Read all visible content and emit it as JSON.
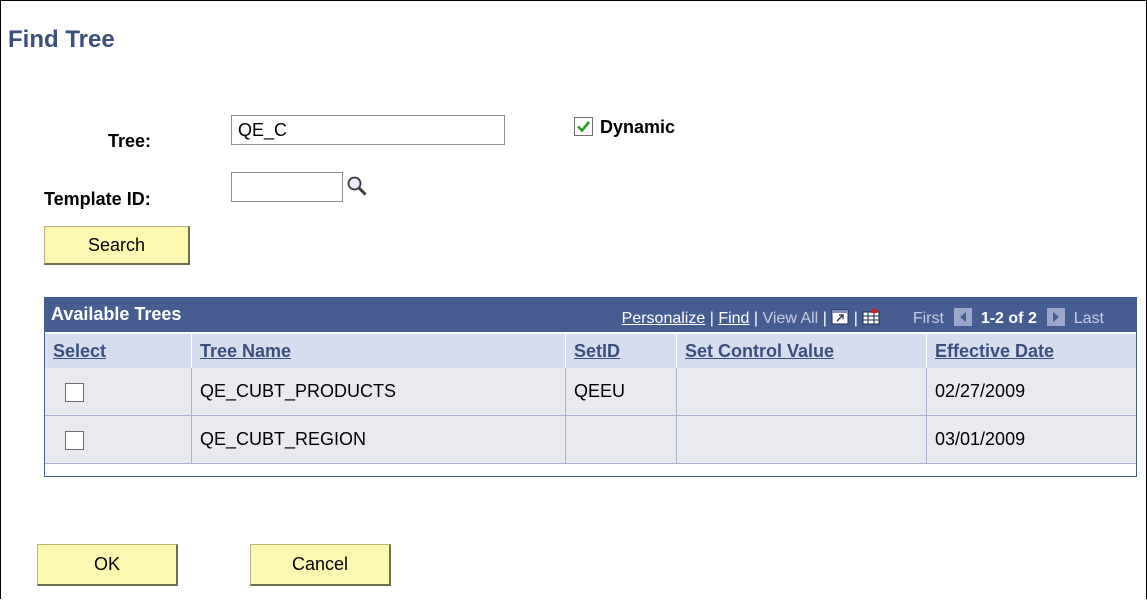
{
  "page": {
    "title": "Find Tree"
  },
  "form": {
    "tree_label": "Tree:",
    "tree_value": "QE_C",
    "dynamic_label": "Dynamic",
    "dynamic_checked": true,
    "template_label": "Template ID:",
    "template_value": "",
    "search_label": "Search"
  },
  "grid": {
    "title": "Available Trees",
    "personalize": "Personalize",
    "find": "Find",
    "view_all": "View All",
    "first": "First",
    "range": "1-2 of 2",
    "last": "Last",
    "columns": [
      "Select",
      "Tree Name",
      "SetID",
      "Set Control Value",
      "Effective Date"
    ],
    "rows": [
      {
        "select": false,
        "tree_name": "QE_CUBT_PRODUCTS",
        "setid": "QEEU",
        "set_control_value": "",
        "effective_date": "02/27/2009"
      },
      {
        "select": false,
        "tree_name": "QE_CUBT_REGION",
        "setid": "",
        "set_control_value": "",
        "effective_date": "03/01/2009"
      }
    ]
  },
  "footer": {
    "ok_label": "OK",
    "cancel_label": "Cancel"
  }
}
